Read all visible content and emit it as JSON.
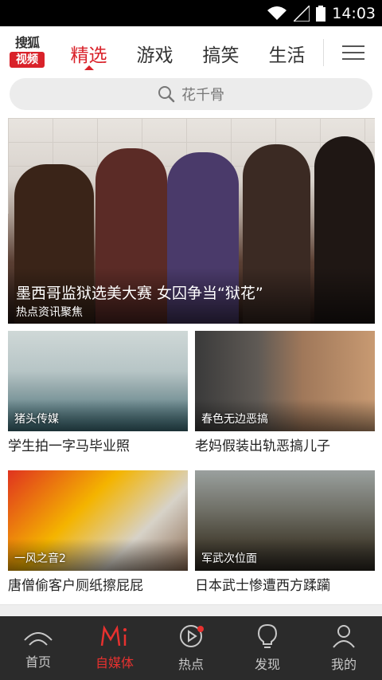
{
  "status_bar": {
    "time": "14:03"
  },
  "header": {
    "logo": {
      "top": "搜狐",
      "bottom": "视频"
    },
    "tabs": [
      {
        "label": "精选",
        "active": true
      },
      {
        "label": "游戏",
        "active": false
      },
      {
        "label": "搞笑",
        "active": false
      },
      {
        "label": "生活",
        "active": false
      }
    ],
    "accent_color": "#d9222a"
  },
  "search": {
    "placeholder": "花千骨"
  },
  "hero": {
    "title": "墨西哥监狱选美大赛 女囚争当“狱花”",
    "source": "热点资讯聚焦"
  },
  "cards": [
    {
      "tag": "猪头传媒",
      "title": "学生拍一字马毕业照"
    },
    {
      "tag": "春色无边恶搞",
      "title": "老妈假装出轨恶搞儿子"
    },
    {
      "tag": "一风之音2",
      "title": "唐僧偷客户厕纸擦屁屁"
    },
    {
      "tag": "军武次位面",
      "title": "日本武士惨遭西方蹂躏"
    }
  ],
  "bottom_nav": [
    {
      "label": "首页",
      "icon": "home-icon",
      "active": false
    },
    {
      "label": "自媒体",
      "icon": "we-media-icon",
      "active": true
    },
    {
      "label": "热点",
      "icon": "play-icon",
      "active": false,
      "badge": true
    },
    {
      "label": "发现",
      "icon": "lightbulb-icon",
      "active": false
    },
    {
      "label": "我的",
      "icon": "user-icon",
      "active": false
    }
  ]
}
